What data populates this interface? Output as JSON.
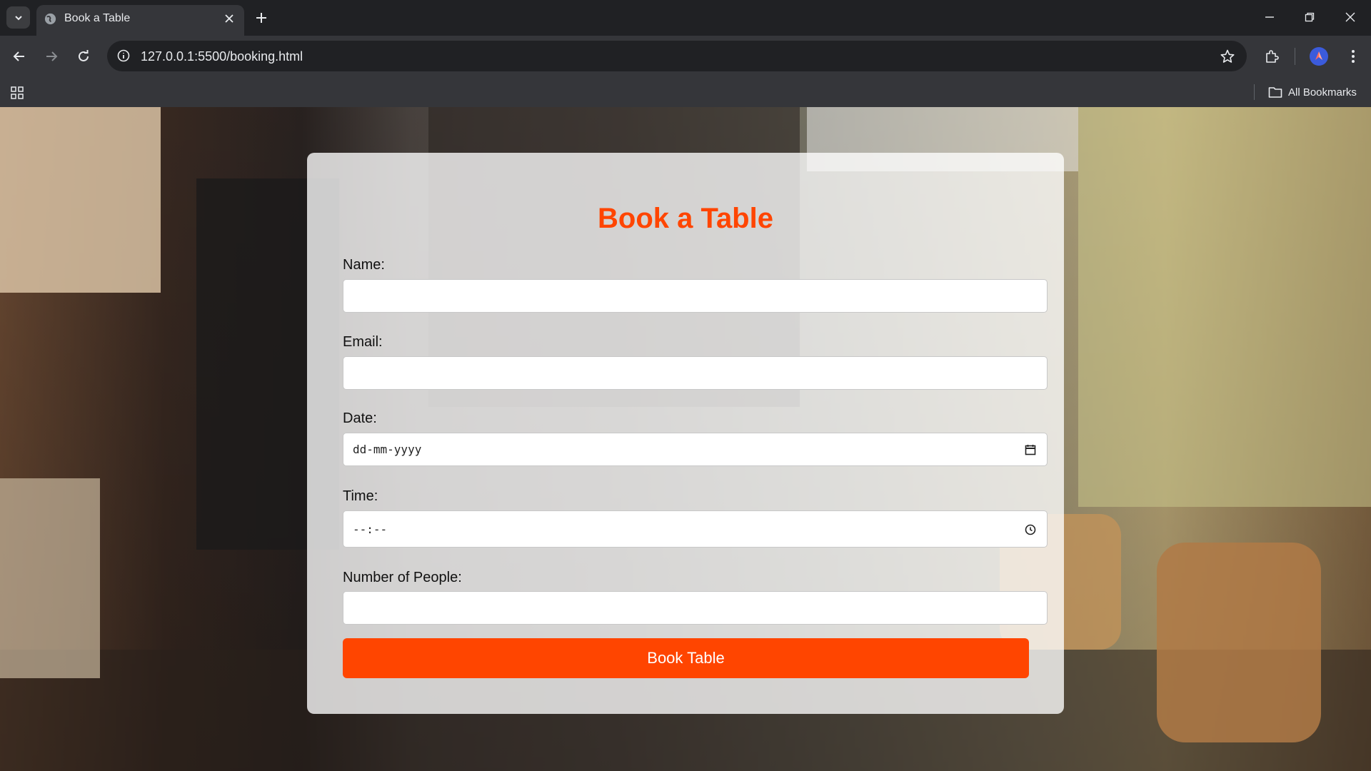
{
  "browser": {
    "tab_title": "Book a Table",
    "url": "127.0.0.1:5500/booking.html",
    "bookmarks_label": "All Bookmarks"
  },
  "form": {
    "title": "Book a Table",
    "fields": [
      {
        "label": "Name:",
        "value": ""
      },
      {
        "label": "Email:",
        "value": ""
      },
      {
        "label": "Date:",
        "placeholder": "dd-mm-yyyy"
      },
      {
        "label": "Time:",
        "placeholder": "--:--"
      },
      {
        "label": "Number of People:",
        "value": ""
      }
    ],
    "submit_label": "Book Table"
  },
  "colors": {
    "accent": "#ff4500",
    "card": "#ffffffc7",
    "browser_dark": "#202124",
    "browser_toolbar": "#35363a"
  },
  "icons": [
    "tab-search-icon",
    "globe-icon",
    "close-icon",
    "plus-icon",
    "minimize-icon",
    "restore-icon",
    "back-icon",
    "forward-icon",
    "reload-icon",
    "site-info-icon",
    "star-icon",
    "extensions-icon",
    "profile-icon",
    "more-icon",
    "apps-icon",
    "folder-icon",
    "calendar-icon",
    "clock-icon"
  ]
}
